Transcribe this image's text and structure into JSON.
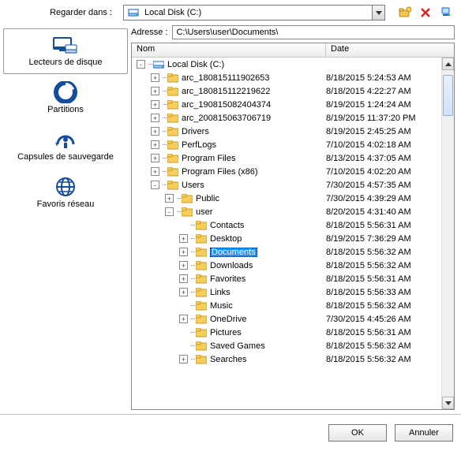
{
  "top": {
    "look_in_label": "Regarder dans :",
    "combo_value": "Local Disk (C:)"
  },
  "address": {
    "label": "Adresse :",
    "value": "C:\\Users\\user\\Documents\\"
  },
  "sidebar": {
    "items": [
      {
        "label": "Lecteurs de disque",
        "icon": "disk-drives-icon"
      },
      {
        "label": "Partitions",
        "icon": "partitions-icon"
      },
      {
        "label": "Capsules de sauvegarde",
        "icon": "backup-capsules-icon"
      },
      {
        "label": "Favoris réseau",
        "icon": "network-favorites-icon"
      }
    ]
  },
  "columns": {
    "name": "Nom",
    "date": "Date"
  },
  "buttons": {
    "ok": "OK",
    "cancel": "Annuler"
  },
  "tree": [
    {
      "depth": 0,
      "expander": "-",
      "icon": "disk",
      "label": "Local Disk (C:)",
      "date": "",
      "selected": false
    },
    {
      "depth": 1,
      "expander": "+",
      "icon": "folder",
      "label": "arc_180815111902653",
      "date": "8/18/2015 5:24:53 AM",
      "selected": false
    },
    {
      "depth": 1,
      "expander": "+",
      "icon": "folder",
      "label": "arc_180815112219622",
      "date": "8/18/2015 4:22:27 AM",
      "selected": false
    },
    {
      "depth": 1,
      "expander": "+",
      "icon": "folder",
      "label": "arc_190815082404374",
      "date": "8/19/2015 1:24:24 AM",
      "selected": false
    },
    {
      "depth": 1,
      "expander": "+",
      "icon": "folder",
      "label": "arc_200815063706719",
      "date": "8/19/2015 11:37:20 PM",
      "selected": false
    },
    {
      "depth": 1,
      "expander": "+",
      "icon": "folder",
      "label": "Drivers",
      "date": "8/19/2015 2:45:25 AM",
      "selected": false
    },
    {
      "depth": 1,
      "expander": "+",
      "icon": "folder",
      "label": "PerfLogs",
      "date": "7/10/2015 4:02:18 AM",
      "selected": false
    },
    {
      "depth": 1,
      "expander": "+",
      "icon": "folder",
      "label": "Program Files",
      "date": "8/13/2015 4:37:05 AM",
      "selected": false
    },
    {
      "depth": 1,
      "expander": "+",
      "icon": "folder",
      "label": "Program Files (x86)",
      "date": "7/10/2015 4:02:20 AM",
      "selected": false
    },
    {
      "depth": 1,
      "expander": "-",
      "icon": "folder",
      "label": "Users",
      "date": "7/30/2015 4:57:35 AM",
      "selected": false
    },
    {
      "depth": 2,
      "expander": "+",
      "icon": "folder",
      "label": "Public",
      "date": "7/30/2015 4:39:29 AM",
      "selected": false
    },
    {
      "depth": 2,
      "expander": "-",
      "icon": "folder",
      "label": "user",
      "date": "8/20/2015 4:31:40 AM",
      "selected": false
    },
    {
      "depth": 3,
      "expander": "",
      "icon": "folder",
      "label": "Contacts",
      "date": "8/18/2015 5:56:31 AM",
      "selected": false
    },
    {
      "depth": 3,
      "expander": "+",
      "icon": "folder",
      "label": "Desktop",
      "date": "8/19/2015 7:36:29 AM",
      "selected": false
    },
    {
      "depth": 3,
      "expander": "+",
      "icon": "folder",
      "label": "Documents",
      "date": "8/18/2015 5:56:32 AM",
      "selected": true
    },
    {
      "depth": 3,
      "expander": "+",
      "icon": "folder",
      "label": "Downloads",
      "date": "8/18/2015 5:56:32 AM",
      "selected": false
    },
    {
      "depth": 3,
      "expander": "+",
      "icon": "folder",
      "label": "Favorites",
      "date": "8/18/2015 5:56:31 AM",
      "selected": false
    },
    {
      "depth": 3,
      "expander": "+",
      "icon": "folder",
      "label": "Links",
      "date": "8/18/2015 5:56:33 AM",
      "selected": false
    },
    {
      "depth": 3,
      "expander": "",
      "icon": "folder",
      "label": "Music",
      "date": "8/18/2015 5:56:32 AM",
      "selected": false
    },
    {
      "depth": 3,
      "expander": "+",
      "icon": "folder",
      "label": "OneDrive",
      "date": "7/30/2015 4:45:26 AM",
      "selected": false
    },
    {
      "depth": 3,
      "expander": "",
      "icon": "folder",
      "label": "Pictures",
      "date": "8/18/2015 5:56:31 AM",
      "selected": false
    },
    {
      "depth": 3,
      "expander": "",
      "icon": "folder",
      "label": "Saved Games",
      "date": "8/18/2015 5:56:32 AM",
      "selected": false
    },
    {
      "depth": 3,
      "expander": "+",
      "icon": "folder",
      "label": "Searches",
      "date": "8/18/2015 5:56:32 AM",
      "selected": false
    }
  ]
}
